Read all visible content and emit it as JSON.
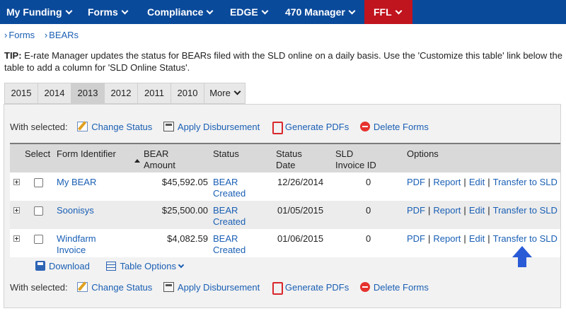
{
  "nav": {
    "items": [
      {
        "label": "My Funding"
      },
      {
        "label": "Forms"
      },
      {
        "label": "Compliance"
      },
      {
        "label": "EDGE"
      },
      {
        "label": "470 Manager"
      },
      {
        "label": "FFL"
      }
    ],
    "active_color": "#c0141e",
    "bar_color": "#0a4a9b"
  },
  "breadcrumb": [
    "Forms",
    "BEARs"
  ],
  "tip": {
    "label": "TIP:",
    "text": " E-rate Manager updates the status for BEARs filed with the SLD online on a daily basis. Use the 'Customize this table' link below the table to add a column for 'SLD Online Status'."
  },
  "tabs": [
    "2015",
    "2014",
    "2013",
    "2012",
    "2011",
    "2010",
    "More"
  ],
  "active_tab": "2013",
  "actions": {
    "with_selected": "With selected:",
    "change_status": "Change Status",
    "apply_disbursement": "Apply Disbursement",
    "generate_pdfs": "Generate PDFs",
    "delete_forms": "Delete Forms"
  },
  "table": {
    "headers": {
      "select": "Select",
      "form_identifier": "Form Identifier",
      "bear_amount": "BEAR Amount",
      "status": "Status",
      "status_date": "Status Date",
      "sld_invoice_id": "SLD Invoice ID",
      "options": "Options"
    },
    "rows": [
      {
        "form_identifier": "My BEAR",
        "amount": "$45,592.05",
        "status": "BEAR Created",
        "date": "12/26/2014",
        "invoice": "0"
      },
      {
        "form_identifier": "Soonisys",
        "amount": "$25,500.00",
        "status": "BEAR Created",
        "date": "01/05/2015",
        "invoice": "0"
      },
      {
        "form_identifier": "Windfarm Invoice",
        "amount": "$4,082.59",
        "status": "BEAR Created",
        "date": "01/06/2015",
        "invoice": "0"
      }
    ],
    "options": {
      "pdf": "PDF",
      "report": "Report",
      "edit": "Edit",
      "transfer": "Transfer to SLD",
      "sep": "|"
    }
  },
  "tools": {
    "download": "Download",
    "table_options": "Table Options"
  },
  "annotation_arrow_color": "#2a5bd7"
}
